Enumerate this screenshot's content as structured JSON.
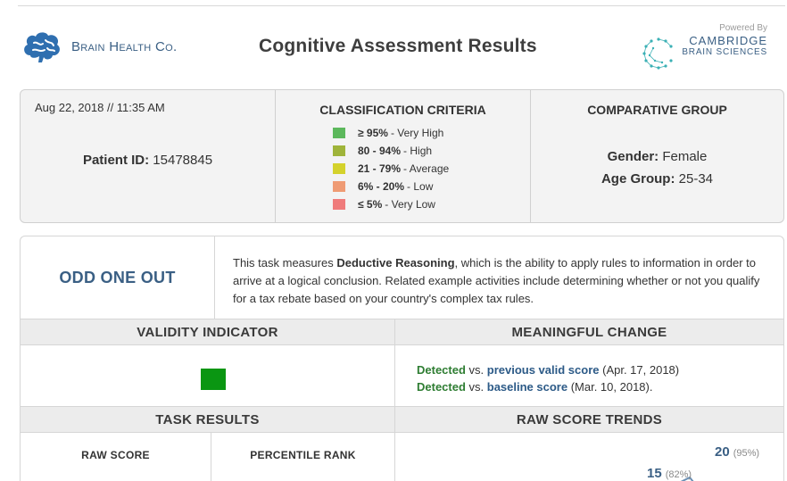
{
  "header": {
    "brand_name": "Brain Health Co.",
    "title": "Cognitive Assessment Results",
    "powered_by": "Powered By",
    "partner_name": "CAMBRIDGE",
    "partner_sub": "BRAIN SCIENCES"
  },
  "info": {
    "datetime": "Aug 22, 2018 // 11:35 AM",
    "patient_label": "Patient ID:",
    "patient_id": "15478845",
    "criteria_title": "CLASSIFICATION CRITERIA",
    "criteria": [
      {
        "range": "≥ 95%",
        "label": " - Very High",
        "color": "#5cb85c"
      },
      {
        "range": "80 - 94%",
        "label": " - High",
        "color": "#9fb43a"
      },
      {
        "range": "21 - 79%",
        "label": " - Average",
        "color": "#d4d22c"
      },
      {
        "range": "6% - 20%",
        "label": " - Low",
        "color": "#ef9b74"
      },
      {
        "range": "≤ 5%",
        "label": " - Very Low",
        "color": "#ef7b7b"
      }
    ],
    "comparative_title": "COMPARATIVE GROUP",
    "gender_label": "Gender:",
    "gender": "Female",
    "age_label": "Age Group:",
    "age_group": "25-34"
  },
  "task": {
    "name": "ODD ONE OUT",
    "desc_pre": "This task measures ",
    "desc_bold": "Deductive Reasoning",
    "desc_post": ", which is the ability to apply rules to information in order to arrive at a logical conclusion. Related example activities include determining whether or not you qualify for a tax rebate based on your country's complex tax rules.",
    "validity_header": "VALIDITY INDICATOR",
    "validity_color": "#0a9612",
    "change_header": "MEANINGFUL CHANGE",
    "change_lines": [
      {
        "status": "Detected",
        "vs": " vs. ",
        "ref": "previous valid score",
        "date": " (Apr. 17, 2018)"
      },
      {
        "status": "Detected",
        "vs": " vs. ",
        "ref": "baseline score",
        "date": " (Mar. 10, 2018)."
      }
    ],
    "results_header": "TASK RESULTS",
    "trends_header": "RAW SCORE TRENDS",
    "raw_score_label": "RAW SCORE",
    "percentile_label": "PERCENTILE RANK"
  },
  "chart_data": {
    "type": "line",
    "title": "RAW SCORE TRENDS",
    "points": [
      {
        "score": 15,
        "percentile": "(82%)"
      },
      {
        "score": 20,
        "percentile": "(95%)"
      }
    ],
    "line_color": "#6a8fb5",
    "marker_color": "#5cb85c"
  }
}
